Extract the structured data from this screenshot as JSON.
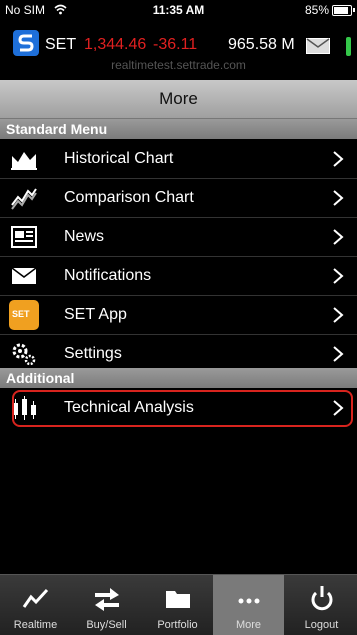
{
  "status": {
    "carrier": "No SIM",
    "time": "11:35 AM",
    "battery": "85%",
    "battery_level": 0.85
  },
  "ticker": {
    "name": "SET",
    "value": "1,344.46",
    "change": "-36.11",
    "volume": "965.58 M",
    "server": "realtimetest.settrade.com"
  },
  "header": {
    "title": "More"
  },
  "sections": {
    "standard": "Standard Menu",
    "additional": "Additional"
  },
  "menu": {
    "historical": "Historical Chart",
    "comparison": "Comparison Chart",
    "news": "News",
    "notifications": "Notifications",
    "setapp": "SET App",
    "settings": "Settings",
    "technical": "Technical Analysis"
  },
  "setapp_icon_text": "SET",
  "tabs": {
    "realtime": "Realtime",
    "buysell": "Buy/Sell",
    "portfolio": "Portfolio",
    "more": "More",
    "logout": "Logout"
  },
  "colors": {
    "negative": "#e02020",
    "accent": "#1e6fd9",
    "highlight": "#d8241e"
  }
}
